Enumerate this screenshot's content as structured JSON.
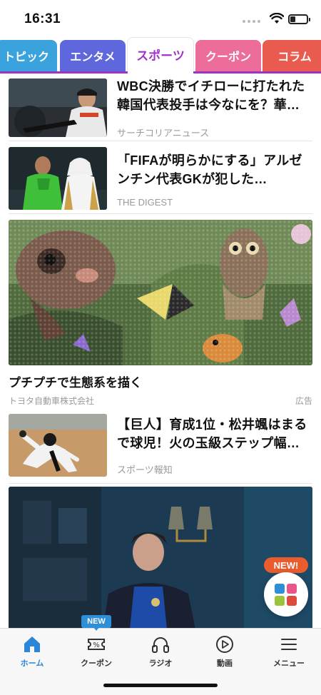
{
  "status_bar": {
    "time": "16:31"
  },
  "tabs": [
    {
      "label": "トピック",
      "color": "#3aa3de"
    },
    {
      "label": "エンタメ",
      "color": "#5e67dc"
    },
    {
      "label": "スポーツ",
      "color": "#a032c8",
      "active": true
    },
    {
      "label": "クーポン",
      "color": "#ec6d99"
    },
    {
      "label": "コラム",
      "color": "#ea5b4f"
    }
  ],
  "articles": [
    {
      "title": "WBC決勝でイチローに打たれた韓国代表投手は今なにを？華や…",
      "source": "サーチコリアニュース",
      "thumb_icon": "baseball-player-photo"
    },
    {
      "title": "「FIFAが明らかにする」アルゼンチン代表GKが犯した…",
      "source": "THE DIGEST",
      "thumb_icon": "soccer-goalkeeper-photo"
    },
    {
      "title": "【巨人】育成1位・松井颯はまるで球児！火の玉級ステップ幅6・…",
      "source": "スポーツ報知",
      "thumb_icon": "pitcher-photo"
    }
  ],
  "ad": {
    "title": "プチプチで生態系を描く",
    "advertiser": "トヨタ自動車株式会社",
    "label": "広告"
  },
  "floating_button": {
    "badge": "NEW!",
    "colors": [
      "#2e8fd6",
      "#e8568c",
      "#9bc43a",
      "#e04a3c"
    ]
  },
  "bottom_nav": {
    "new_badge": "NEW",
    "items": [
      {
        "label": "ホーム",
        "icon": "home-icon",
        "active": true
      },
      {
        "label": "クーポン",
        "icon": "coupon-icon"
      },
      {
        "label": "ラジオ",
        "icon": "headphones-icon"
      },
      {
        "label": "動画",
        "icon": "play-icon"
      },
      {
        "label": "メニュー",
        "icon": "menu-icon"
      }
    ]
  }
}
